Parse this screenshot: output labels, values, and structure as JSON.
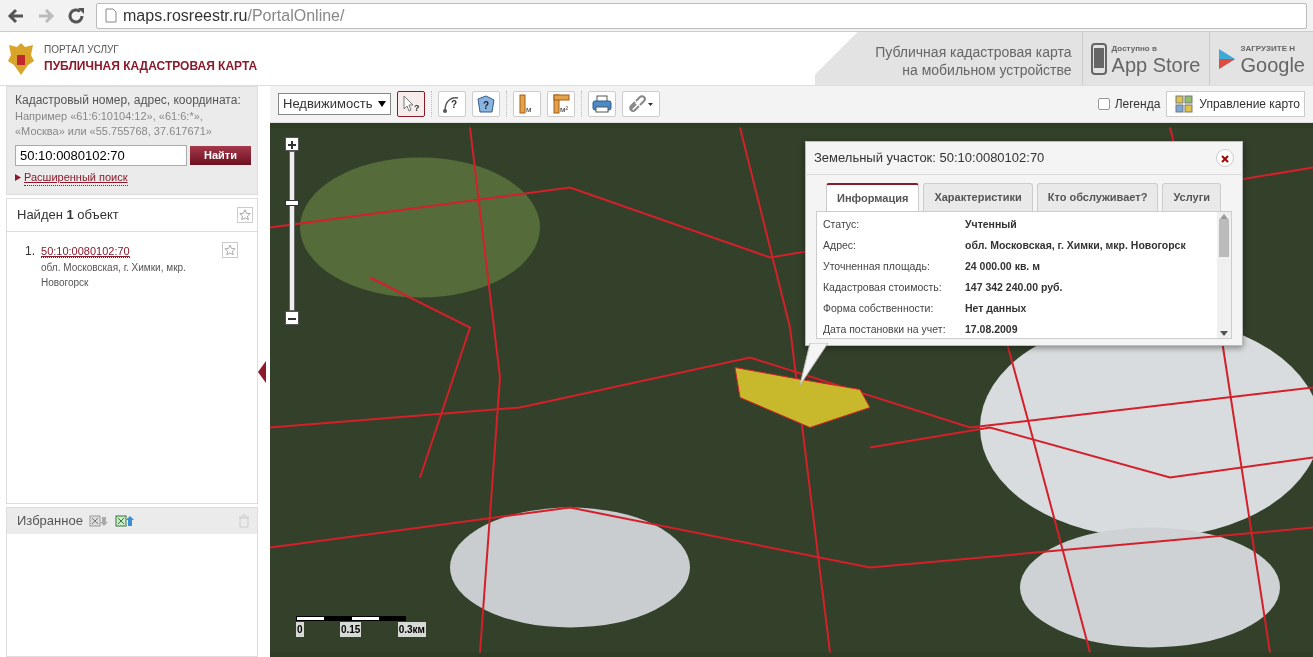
{
  "browser": {
    "url_host": "maps.rosreestr.ru",
    "url_path": "/PortalOnline/"
  },
  "header": {
    "portal_label": "ПОРТАЛ УСЛУГ",
    "title": "ПУБЛИЧНАЯ КАДАСТРОВАЯ КАРТА",
    "mobile_promo": [
      "Публичная кадастровая карта",
      "на мобильном устройстве"
    ],
    "app_store": {
      "caption": "Доступно в",
      "name": "App Store"
    },
    "google_play": {
      "caption": "ЗАГРУЗИТЕ Н",
      "name": "Google"
    }
  },
  "search": {
    "label": "Кадастровый номер, адрес, координата:",
    "hint": [
      "Например «61:6:10104:12», «61:6:*»,",
      "«Москва» или «55.755768, 37.617671»"
    ],
    "value": "50:10:0080102:70",
    "button": "Найти",
    "advanced_link": "Расширенный поиск"
  },
  "results": {
    "heading": "Найден **1** объект",
    "items": [
      {
        "index": "1.",
        "number": "50:10:0080102:70",
        "address": "обл. Московская, г. Химки, мкр. Новогорск"
      }
    ]
  },
  "favorites": {
    "title": "Избранное"
  },
  "toolbar": {
    "layer_select": "Недвижимость",
    "tools": [
      {
        "kind": "identify",
        "glyph": "?",
        "selected": true
      },
      {
        "kind": "path-query",
        "glyph": "?",
        "selected": false
      },
      {
        "kind": "area-query",
        "glyph": "?",
        "selected": false
      },
      {
        "kind": "ruler",
        "glyph": "м",
        "selected": false
      },
      {
        "kind": "area-ruler",
        "glyph": "м²",
        "selected": false
      },
      {
        "kind": "print",
        "selected": false
      },
      {
        "kind": "link",
        "selected": false
      }
    ],
    "legend": {
      "label": "Легенда",
      "checked": false
    },
    "map_control": "Управление карто"
  },
  "map": {
    "zoom": {
      "level": 0.69
    },
    "scale_labels": [
      "0",
      "0.15",
      "0.3км"
    ]
  },
  "popup": {
    "title": "Земельный участок: 50:10:0080102:70",
    "tabs": [
      {
        "label": "Информация",
        "selected": true
      },
      {
        "label": "Характеристики",
        "selected": false
      },
      {
        "label": "Кто обслуживает?",
        "selected": false
      },
      {
        "label": "Услуги",
        "selected": false
      }
    ],
    "rows": [
      {
        "label": "Статус:",
        "value": "Учтенный"
      },
      {
        "label": "Адрес:",
        "value": "обл. Московская, г. Химки, мкр. Новогорск"
      },
      {
        "label": "Уточненная площадь:",
        "value": "24 000.00 кв. м"
      },
      {
        "label": "Кадастровая стоимость:",
        "value": "147 342 240.00 руб."
      },
      {
        "label": "Форма собственности:",
        "value": "Нет данных"
      },
      {
        "label": "Дата постановки на учет:",
        "value": "17.08.2009"
      }
    ]
  }
}
